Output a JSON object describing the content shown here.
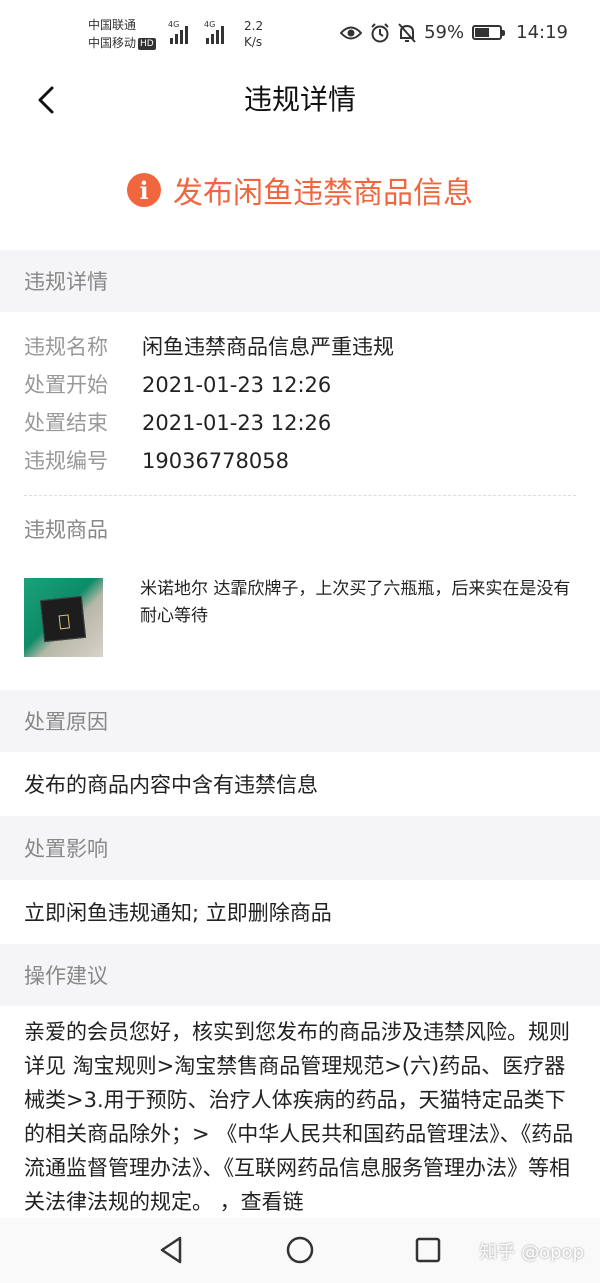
{
  "status_bar": {
    "carrier1": "中国联通",
    "carrier2": "中国移动",
    "hd": "HD",
    "net1": "4G",
    "net2": "4G",
    "speed_value": "2.2",
    "speed_unit": "K/s",
    "battery": "59%",
    "battery_level": 0.59,
    "time": "14:19",
    "icons": [
      "eye-icon",
      "alarm-icon",
      "mute-bell-icon",
      "battery-icon"
    ]
  },
  "header": {
    "title": "违规详情",
    "back_icon": "chevron-left-icon"
  },
  "alert": {
    "icon": "exclamation-icon",
    "text": "发布闲鱼违禁商品信息",
    "color": "#f1653f"
  },
  "details": {
    "section_title": "违规详情",
    "rows": [
      {
        "label": "违规名称",
        "value": "闲鱼违禁商品信息严重违规"
      },
      {
        "label": "处置开始",
        "value": "2021-01-23 12:26"
      },
      {
        "label": "处置结束",
        "value": "2021-01-23 12:26"
      },
      {
        "label": "违规编号",
        "value": "19036778058"
      }
    ],
    "goods_label": "违规商品",
    "goods_desc": "米诺地尔 达霏欣牌子，上次买了六瓶瓶，后来实在是没有耐心等待"
  },
  "reason": {
    "title": "处置原因",
    "text": "发布的商品内容中含有违禁信息"
  },
  "impact": {
    "title": "处置影响",
    "text": "立即闲鱼违规通知; 立即删除商品"
  },
  "suggestion": {
    "title": "操作建议",
    "text": "亲爱的会员您好，核实到您发布的商品涉及违禁风险。规则详见 淘宝规则>淘宝禁售商品管理规范>(六)药品、医疗器械类>3.用于预防、治疗人体疾病的药品，天猫特定品类下的相关商品除外；> 《中华人民共和国药品管理法》、《药品流通监督管理办法》、《互联网药品信息服务管理办法》等相关法律法规的规定。 ，查看链"
  },
  "nav": {
    "icons": [
      "back-triangle-icon",
      "home-circle-icon",
      "recents-square-icon"
    ],
    "watermark": "知乎 @opop"
  }
}
